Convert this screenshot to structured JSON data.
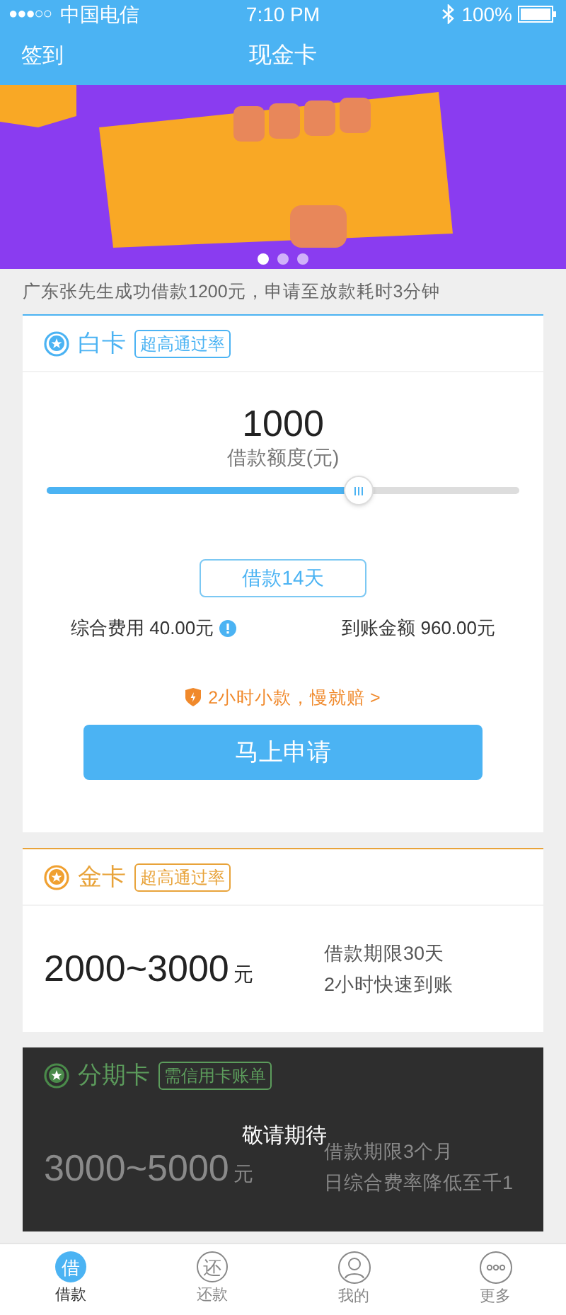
{
  "status_bar": {
    "signal": "●●●○○",
    "carrier": "中国电信",
    "time": "7:10 PM",
    "battery": "100%"
  },
  "nav": {
    "left": "签到",
    "title": "现金卡"
  },
  "banner": {
    "dots": [
      {
        "selected": true
      },
      {
        "selected": false
      },
      {
        "selected": false
      }
    ]
  },
  "notice": "广东张先生成功借款1200元，申请至放款耗时3分钟",
  "white_card": {
    "title": "白卡",
    "tag": "超高通过率",
    "amount": "1000",
    "amount_label": "借款额度(元)",
    "level": 0.66,
    "term": "借款14天",
    "fee": "综合费用 40.00元",
    "received": "到账金额 960.00元",
    "promise": "2小时小款，慢就赔 >",
    "apply": "马上申请"
  },
  "cards": [
    {
      "kind": "gold",
      "title": "金卡",
      "tag": "超高通过率",
      "range": "2000~3000",
      "unit": "元",
      "lines": [
        "借款期限30天",
        "2小时快速到账"
      ],
      "locked": false
    },
    {
      "kind": "installment",
      "title": "分期卡",
      "tag": "需信用卡账单",
      "range": "3000~5000",
      "unit": "元",
      "lines": [
        "借款期限3个月",
        "日综合费率降低至千1"
      ],
      "locked": true,
      "overlay": "敬请期待"
    }
  ],
  "tab_bar": [
    {
      "kind": "char",
      "glyph": "借",
      "label": "借款",
      "selected": true
    },
    {
      "kind": "char",
      "glyph": "还",
      "label": "还款",
      "selected": false
    },
    {
      "kind": "person",
      "label": "我的",
      "selected": false
    },
    {
      "kind": "more",
      "label": "更多",
      "selected": false
    }
  ]
}
